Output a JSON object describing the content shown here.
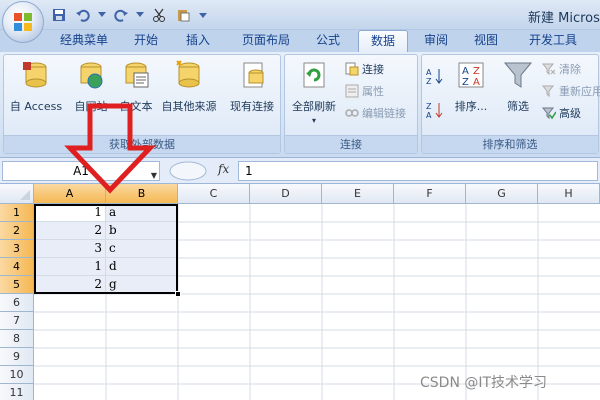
{
  "window": {
    "title": "新建 Micros"
  },
  "tabs": [
    {
      "label": "经典菜单"
    },
    {
      "label": "开始"
    },
    {
      "label": "插入"
    },
    {
      "label": "页面布局"
    },
    {
      "label": "公式"
    },
    {
      "label": "数据",
      "active": true
    },
    {
      "label": "审阅"
    },
    {
      "label": "视图"
    },
    {
      "label": "开发工具"
    }
  ],
  "ribbon": {
    "get_external": {
      "group_label": "获取外部数据",
      "from_access": "自 Access",
      "from_web": "自网站",
      "from_text": "自文本",
      "from_other": "自其他来源",
      "existing_conn": "现有连接"
    },
    "connections": {
      "group_label": "连接",
      "refresh_all": "全部刷新",
      "connections": "连接",
      "properties": "属性",
      "edit_links": "编辑链接"
    },
    "sort_filter": {
      "group_label": "排序和筛选",
      "sort": "排序...",
      "filter": "筛选",
      "clear": "清除",
      "reapply": "重新应用",
      "advanced": "高级"
    }
  },
  "formula_bar": {
    "name_box": "A1",
    "fx": "fx",
    "value": "1"
  },
  "grid": {
    "columns": [
      "A",
      "B",
      "C",
      "D",
      "E",
      "F",
      "G",
      "H"
    ],
    "rows": [
      "1",
      "2",
      "3",
      "4",
      "5",
      "6",
      "7",
      "8",
      "9",
      "10",
      "11"
    ],
    "data": [
      {
        "a": "1",
        "b": "a"
      },
      {
        "a": "2",
        "b": "b"
      },
      {
        "a": "3",
        "b": "c"
      },
      {
        "a": "1",
        "b": "d"
      },
      {
        "a": "2",
        "b": "g"
      }
    ]
  },
  "watermark": "CSDN @IT技术学习",
  "colors": {
    "accent": "#15428b",
    "selection_header": "#f5b854",
    "arrow": "#e02020"
  }
}
